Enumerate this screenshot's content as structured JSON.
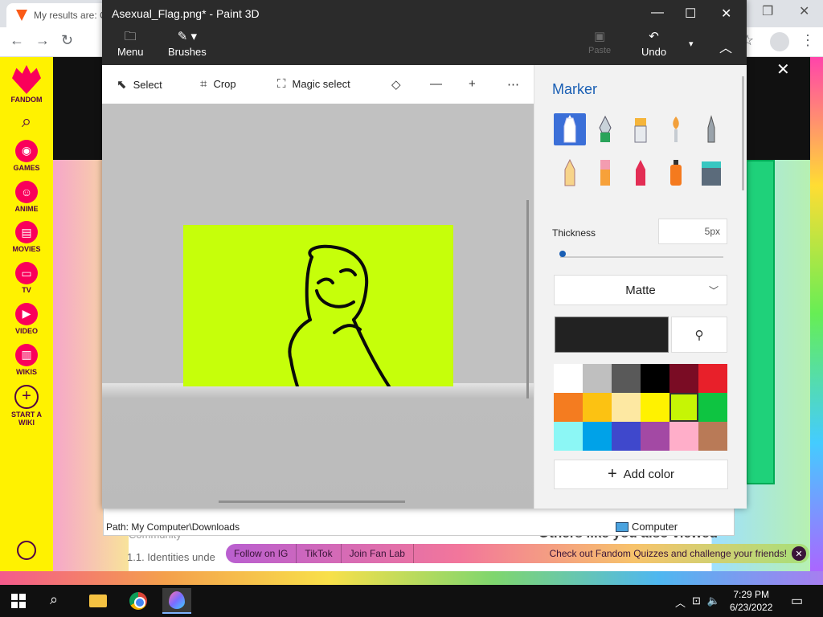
{
  "browser": {
    "tab_title": "My results are: C",
    "avatar_icon": "person-icon"
  },
  "fandom": {
    "logo_label": "FANDOM",
    "nav": [
      {
        "label": "GAMES",
        "icon": "gamepad-icon"
      },
      {
        "label": "ANIME",
        "icon": "anime-face-icon"
      },
      {
        "label": "MOVIES",
        "icon": "film-icon"
      },
      {
        "label": "TV",
        "icon": "tv-icon"
      },
      {
        "label": "VIDEO",
        "icon": "play-icon"
      },
      {
        "label": "WIKIS",
        "icon": "book-icon"
      }
    ],
    "start_wiki": "START A WIKI",
    "toc_item_1": "Community",
    "toc_item": "1.1.  Identities unde",
    "others_heading": "Others like you also viewed",
    "fan_bar": {
      "links": [
        "Follow on IG",
        "TikTok",
        "Join Fan Lab"
      ],
      "message": "Check out Fandom Quizzes and challenge your friends!"
    }
  },
  "explorer": {
    "path": "Path: My Computer\\Downloads",
    "location": "Computer"
  },
  "paint3d": {
    "window_title": "Asexual_Flag.png* - Paint 3D",
    "toolbar": {
      "menu_label": "Menu",
      "brushes_label": "Brushes",
      "paste_label": "Paste",
      "undo_label": "Undo"
    },
    "tools": {
      "select": "Select",
      "crop": "Crop",
      "magic_select": "Magic select"
    },
    "panel": {
      "title": "Marker",
      "brushes": [
        "marker",
        "calligraphy-pen",
        "oil-brush",
        "watercolor",
        "pixel-pen",
        "pencil",
        "eraser",
        "crayon",
        "spray-can",
        "fill-bucket"
      ],
      "selected_brush": "marker",
      "thickness_label": "Thickness",
      "thickness_value": "5px",
      "thickness_fraction": 0.0,
      "finish": "Matte",
      "current_color": "#222222",
      "swatches": [
        "#ffffff",
        "#bfbfbf",
        "#595959",
        "#000000",
        "#7a0c24",
        "#e8202a",
        "#f47c20",
        "#fcc212",
        "#fde8a2",
        "#fff200",
        "#c6f505",
        "#0ec441",
        "#8cf7f5",
        "#00a2e8",
        "#3f48cc",
        "#a349a4",
        "#ffaec9",
        "#b97a57"
      ],
      "selected_swatch": 10,
      "add_color": "Add color"
    },
    "canvas_color": "#c6ff0a"
  },
  "taskbar": {
    "time": "7:29 PM",
    "date": "6/23/2022"
  }
}
